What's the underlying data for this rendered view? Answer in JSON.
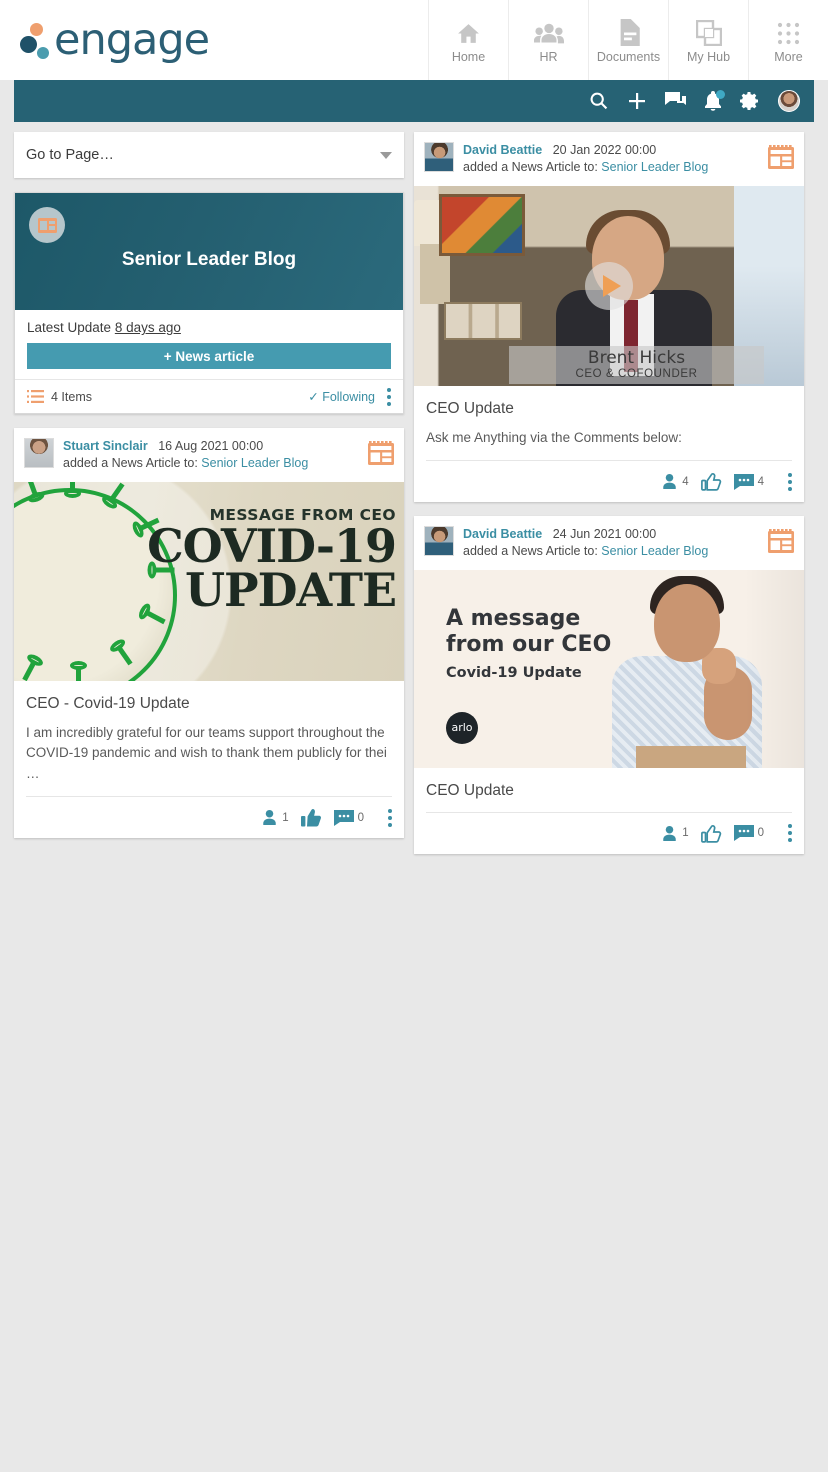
{
  "brand": {
    "name": "engage"
  },
  "topnav": [
    {
      "label": "Home",
      "icon": "home-icon"
    },
    {
      "label": "HR",
      "icon": "people-icon"
    },
    {
      "label": "Documents",
      "icon": "document-icon"
    },
    {
      "label": "My Hub",
      "icon": "hub-icon"
    },
    {
      "label": "More",
      "icon": "grid-icon"
    }
  ],
  "toolbar": {
    "search": "search-icon",
    "add": "plus-icon",
    "chat": "chat-icon",
    "notifications": "bell-icon",
    "settings": "gear-icon",
    "profile": "avatar-icon"
  },
  "sidebar": {
    "goto": {
      "label": "Go to Page…"
    },
    "widget": {
      "title": "Senior Leader Blog",
      "latest_label": "Latest Update",
      "latest_value": "8 days ago",
      "button": "+ News article",
      "items_count": "4 Items",
      "following": "✓ Following",
      "menu": "kebab-menu-icon"
    }
  },
  "posts_left": [
    {
      "author": "Stuart Sinclair",
      "date": "16 Aug 2021 00:00",
      "action": "added a News Article to:",
      "target": "Senior Leader Blog",
      "type_icon": "news-article-icon",
      "image": {
        "kind": "covid-poster",
        "line1": "MESSAGE FROM CEO",
        "line2": "COVID-19",
        "line3": "UPDATE"
      },
      "title": "CEO - Covid-19 Update",
      "excerpt": "I am incredibly grateful for our teams support throughout the COVID-19 pandemic and wish to thank them publicly for thei …",
      "views": "1",
      "likes": "",
      "comments": "0",
      "like_state": "filled"
    }
  ],
  "posts_right": [
    {
      "author": "David Beattie",
      "date": "20 Jan 2022 00:00",
      "action": "added a News Article to:",
      "target": "Senior Leader Blog",
      "type_icon": "news-article-icon",
      "image": {
        "kind": "video",
        "caption_name": "Brent Hicks",
        "caption_role": "CEO & COFOUNDER",
        "play": "play-icon"
      },
      "title": "CEO Update",
      "excerpt": "Ask me Anything via the Comments below:",
      "views": "4",
      "likes": "",
      "comments": "4",
      "like_state": "outline"
    },
    {
      "author": "David Beattie",
      "date": "24 Jun 2021 00:00",
      "action": "added a News Article to:",
      "target": "Senior Leader Blog",
      "type_icon": "news-article-icon",
      "image": {
        "kind": "arlo-poster",
        "line1": "A message",
        "line2": "from our CEO",
        "line3": "Covid-19 Update",
        "badge": "arlo"
      },
      "title": "CEO Update",
      "excerpt": "",
      "views": "1",
      "likes": "",
      "comments": "0",
      "like_state": "outline"
    }
  ],
  "colors": {
    "teal_bar": "#266274",
    "accent_link": "#3b8ea3",
    "accent_orange": "#ef9f6e",
    "button_teal": "#459bb0",
    "page_bg": "#e8e8e8"
  }
}
